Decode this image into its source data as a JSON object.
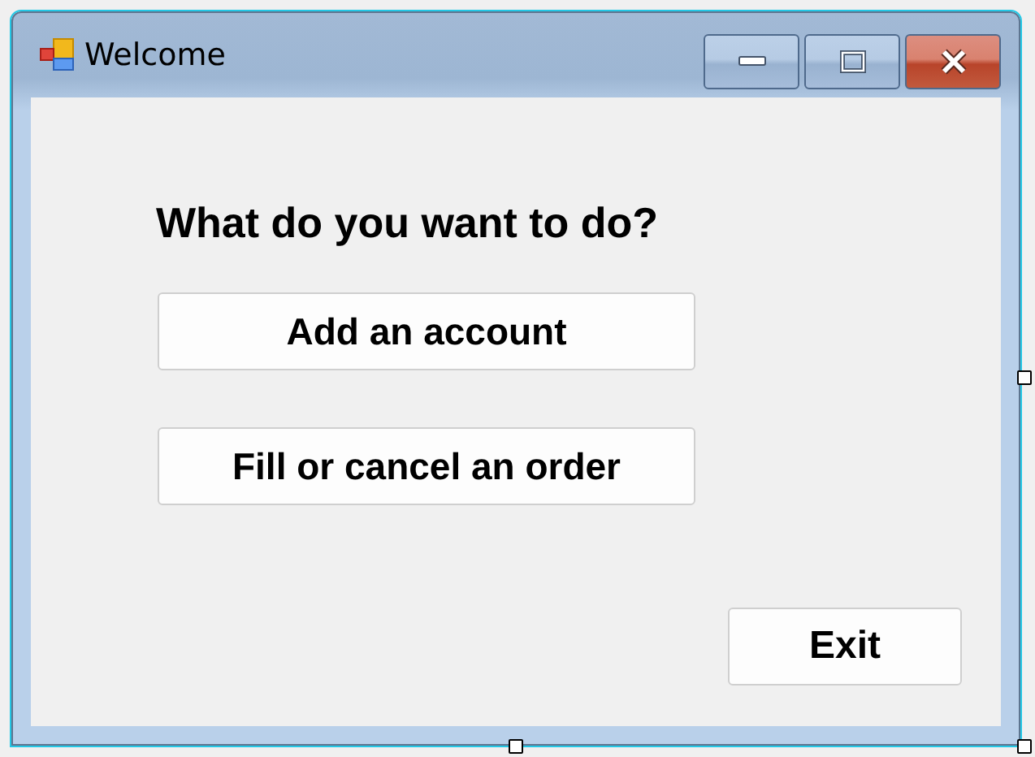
{
  "window": {
    "title": "Welcome"
  },
  "prompt": "What do you want to do?",
  "buttons": [
    {
      "label": "Add an account"
    },
    {
      "label": "Fill or cancel an order"
    }
  ],
  "exit_button": {
    "label": "Exit"
  }
}
